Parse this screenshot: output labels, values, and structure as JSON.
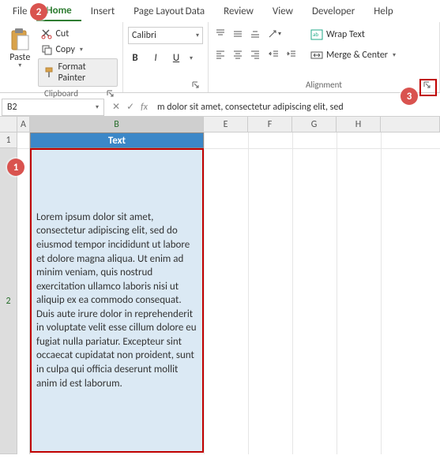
{
  "tabs": {
    "file": "File",
    "home": "Home",
    "insert": "Insert",
    "pagelayout": "Page Layout",
    "data": "Data",
    "review": "Review",
    "view": "View",
    "developer": "Developer",
    "help": "Help"
  },
  "clipboard": {
    "paste": "Paste",
    "cut": "Cut",
    "copy": "Copy",
    "format_painter": "Format Painter",
    "group_label": "Clipboard"
  },
  "font": {
    "name": "Calibri",
    "bold": "B",
    "italic": "I",
    "underline": "U"
  },
  "alignment": {
    "wrap": "Wrap Text",
    "merge": "Merge & Center",
    "group_label": "Alignment"
  },
  "namebox": "B2",
  "formula_bar": "m dolor sit amet, consectetur adipiscing elit, sed",
  "columns": {
    "a": "A",
    "b": "B",
    "e": "E",
    "f": "F",
    "g": "G",
    "h": "H"
  },
  "rows": {
    "r1": "1",
    "r2": "2"
  },
  "cells": {
    "b1": "Text",
    "b2": "Lorem ipsum dolor sit amet, consectetur adipiscing elit, sed do eiusmod tempor incididunt ut labore et dolore magna aliqua. Ut enim ad minim veniam, quis nostrud exercitation ullamco laboris nisi ut aliquip ex ea commodo consequat. Duis aute irure dolor in reprehenderit in voluptate velit esse cillum dolore eu fugiat nulla pariatur. Excepteur sint occaecat cupidatat non proident, sunt in culpa qui officia deserunt mollit anim id est laborum."
  },
  "callouts": {
    "c1": "1",
    "c2": "2",
    "c3": "3"
  }
}
